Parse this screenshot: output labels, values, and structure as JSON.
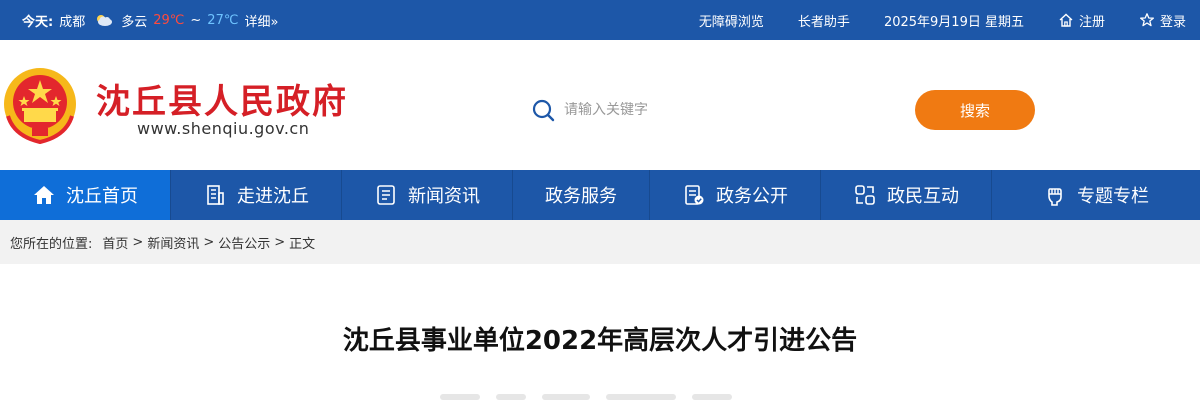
{
  "topbar": {
    "today_label": "今天:",
    "city": "成都",
    "weather_icon": "partly-cloudy-icon",
    "weather": "多云",
    "temp_high": "29℃",
    "tilde": "~",
    "temp_low": "27℃",
    "detail_link": "详细»",
    "accessibility": "无障碍浏览",
    "elder_assist": "长者助手",
    "date": "2025年9月19日 星期五",
    "register": "注册",
    "login": "登录"
  },
  "header": {
    "site_title": "沈丘县人民政府",
    "site_url": "www.shenqiu.gov.cn",
    "search_placeholder": "请输入关键字",
    "search_button": "搜索"
  },
  "nav": {
    "items": [
      {
        "label": "沈丘首页",
        "icon": "home-icon"
      },
      {
        "label": "走进沈丘",
        "icon": "building-icon"
      },
      {
        "label": "新闻资讯",
        "icon": "news-icon"
      },
      {
        "label": "政务服务",
        "icon": ""
      },
      {
        "label": "政务公开",
        "icon": "document-check-icon"
      },
      {
        "label": "政民互动",
        "icon": "interaction-icon"
      },
      {
        "label": "专题专栏",
        "icon": "fist-icon"
      }
    ]
  },
  "breadcrumb": {
    "prefix": "您所在的位置:",
    "items": [
      "首页",
      "新闻资讯",
      "公告公示",
      "正文"
    ],
    "separator": ">"
  },
  "article": {
    "title": "沈丘县事业单位2022年高层次人才引进公告"
  },
  "colors": {
    "primary_blue": "#1d57a8",
    "active_nav": "#0f6ed8",
    "title_red": "#d51f26",
    "search_orange": "#f07a12"
  }
}
